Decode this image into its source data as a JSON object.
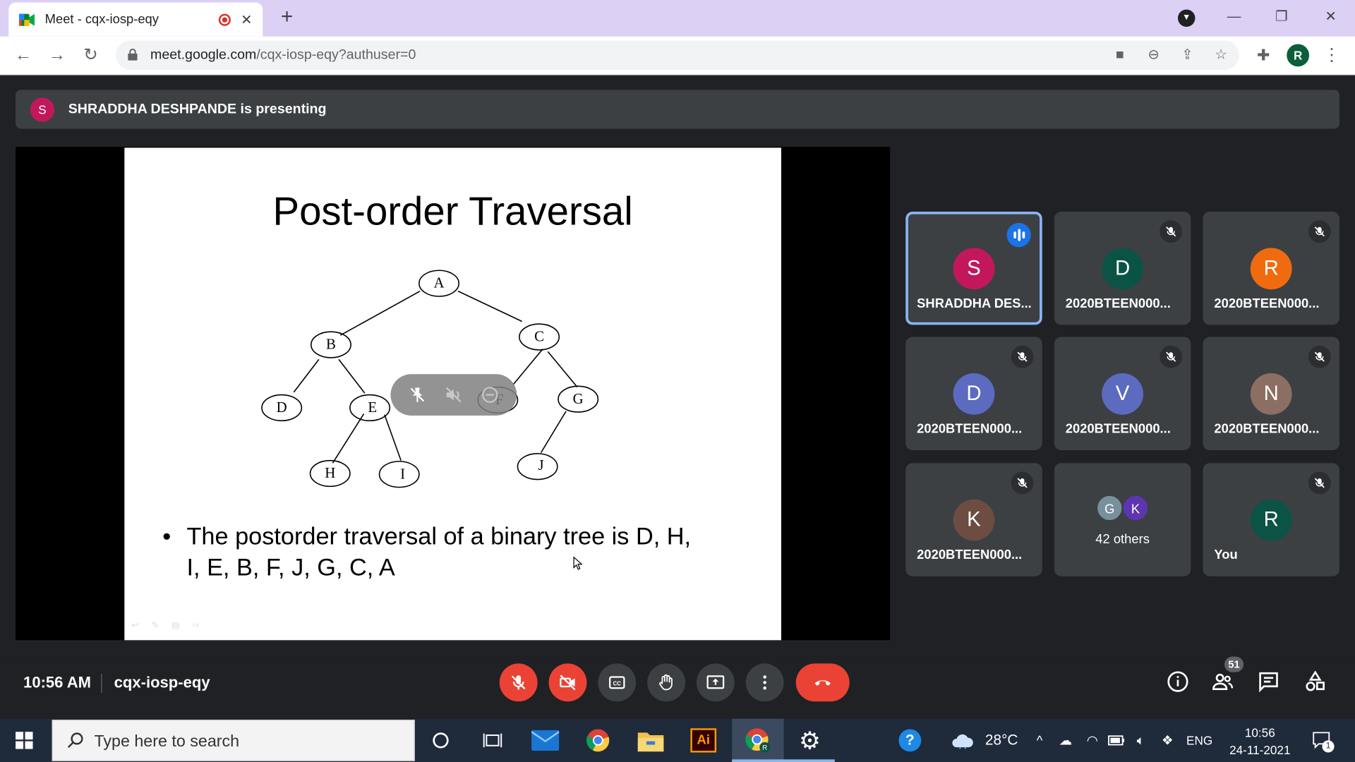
{
  "browser": {
    "tab_title": "Meet - cqx-iosp-eqy",
    "url_host": "meet.google.com",
    "url_path": "/cqx-iosp-eqy?authuser=0",
    "profile_initial": "R"
  },
  "presenting": {
    "initial": "S",
    "text": "SHRADDHA DESHPANDE is presenting"
  },
  "slide": {
    "title": "Post-order Traversal",
    "bullet_line1": "The postorder traversal of a binary tree is D, H,",
    "bullet_line2": "I, E, B, F, J, G, C, A",
    "nodes": [
      "A",
      "B",
      "C",
      "D",
      "E",
      "F",
      "G",
      "H",
      "I",
      "J"
    ]
  },
  "participants": [
    {
      "initial": "S",
      "name": "SHRADDHA DES...",
      "color": "#c2185b",
      "speaking": true
    },
    {
      "initial": "D",
      "name": "2020BTEEN000...",
      "color": "#0b5345",
      "speaking": false
    },
    {
      "initial": "R",
      "name": "2020BTEEN000...",
      "color": "#f06b10",
      "speaking": false
    },
    {
      "initial": "D",
      "name": "2020BTEEN000...",
      "color": "#5c6bc0",
      "speaking": false
    },
    {
      "initial": "V",
      "name": "2020BTEEN000...",
      "color": "#5c6bc0",
      "speaking": false
    },
    {
      "initial": "N",
      "name": "2020BTEEN000...",
      "color": "#8d6e63",
      "speaking": false
    },
    {
      "initial": "K",
      "name": "2020BTEEN000...",
      "color": "#6d4c41",
      "speaking": false
    },
    {
      "initial": "R",
      "name": "You",
      "color": "#0b5345",
      "speaking": false
    }
  ],
  "others": {
    "avatars": [
      {
        "initial": "G",
        "color": "#78909c"
      },
      {
        "initial": "K",
        "color": "#5e35b1"
      }
    ],
    "label": "42 others"
  },
  "meeting": {
    "time": "10:56 AM",
    "code": "cqx-iosp-eqy",
    "participant_count": "51"
  },
  "taskbar": {
    "search_placeholder": "Type here to search",
    "weather": "28°C",
    "language": "ENG",
    "clock_time": "10:56",
    "clock_date": "24-11-2021",
    "notifications": "1"
  }
}
